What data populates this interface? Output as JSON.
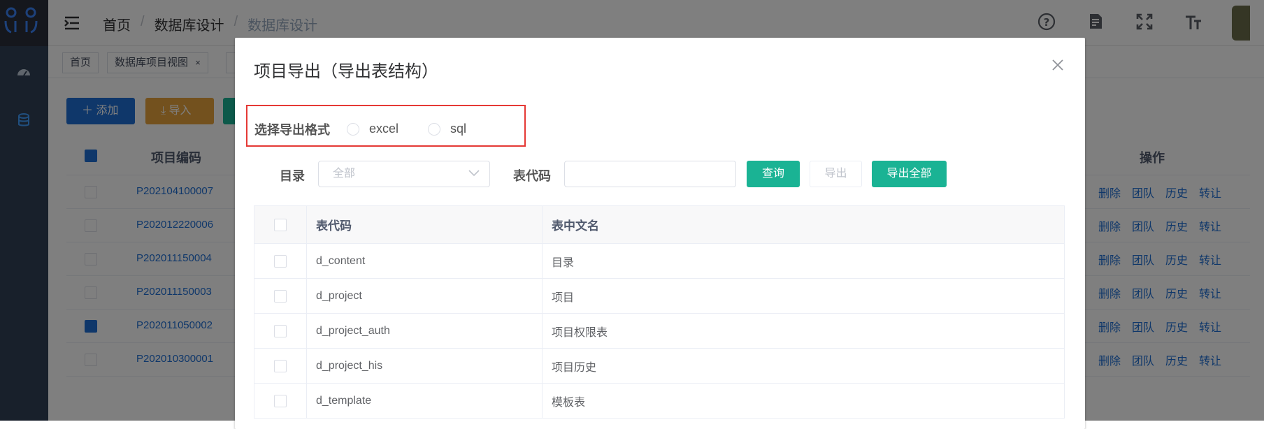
{
  "breadcrumb": {
    "home": "首页",
    "level2": "数据库设计",
    "level3": "数据库设计"
  },
  "tags": {
    "home": "首页",
    "project_view": "数据库项目视图",
    "close": "×"
  },
  "toolbar": {
    "add": "添加",
    "import": "导入"
  },
  "bg_table": {
    "col_code": "项目编码",
    "col_ops": "操作",
    "rows": [
      {
        "code": "P202104100007",
        "checked": false
      },
      {
        "code": "P202012220006",
        "checked": false
      },
      {
        "code": "P202011150004",
        "checked": false
      },
      {
        "code": "P202011150003",
        "checked": false
      },
      {
        "code": "P202011050002",
        "checked": true
      },
      {
        "code": "P202010300001",
        "checked": false
      }
    ],
    "ops": [
      "删除",
      "团队",
      "历史",
      "转让"
    ]
  },
  "dialog": {
    "title": "项目导出（导出表结构）",
    "format_label": "选择导出格式",
    "format_options": [
      "excel",
      "sql"
    ],
    "dir_label": "目录",
    "dir_placeholder": "全部",
    "code_label": "表代码",
    "code_value": "",
    "btn_query": "查询",
    "btn_export": "导出",
    "btn_export_all": "导出全部",
    "table": {
      "headers": [
        "表代码",
        "表中文名"
      ],
      "rows": [
        {
          "code": "d_content",
          "name": "目录"
        },
        {
          "code": "d_project",
          "name": "项目"
        },
        {
          "code": "d_project_auth",
          "name": "项目权限表"
        },
        {
          "code": "d_project_his",
          "name": "项目历史"
        },
        {
          "code": "d_template",
          "name": "模板表"
        }
      ]
    }
  },
  "colors": {
    "sidebar": "#304156",
    "teal": "#1ab394",
    "link": "#1f6fd4",
    "highlight": "#e53935"
  }
}
